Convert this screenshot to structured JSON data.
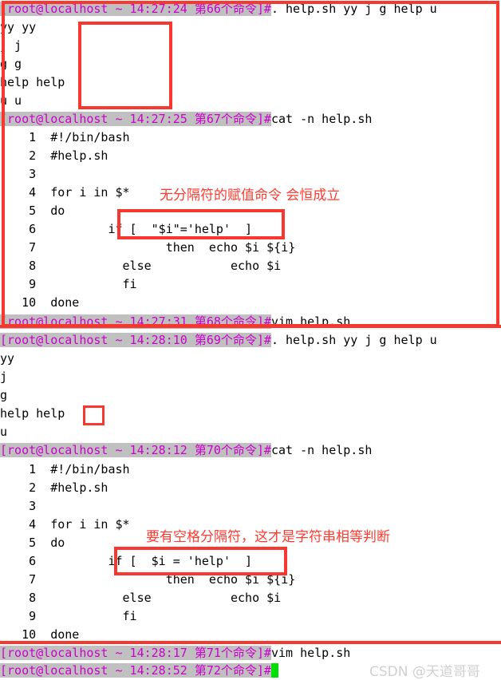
{
  "terminal": {
    "host_user": "root@localhost",
    "cwd": "~",
    "lines": [
      {
        "kind": "prompt",
        "prompt": "[root@localhost ~ 14:27:24 第66个命令]#",
        "command": ". help.sh yy j g help u"
      },
      {
        "kind": "output",
        "text": "yy yy"
      },
      {
        "kind": "output",
        "text": "j j"
      },
      {
        "kind": "output",
        "text": "g g"
      },
      {
        "kind": "output",
        "text": "help help"
      },
      {
        "kind": "output",
        "text": "u u"
      },
      {
        "kind": "prompt",
        "prompt": "[root@localhost ~ 14:27:25 第67个命令]#",
        "command": "cat -n help.sh"
      },
      {
        "kind": "output",
        "text": "     1\t#!/bin/bash"
      },
      {
        "kind": "output",
        "text": "     2\t#help.sh"
      },
      {
        "kind": "output",
        "text": "     3\t"
      },
      {
        "kind": "output",
        "text": "     4\tfor i in $*"
      },
      {
        "kind": "output",
        "text": "     5\tdo"
      },
      {
        "kind": "output",
        "text": "     6\t        if [  \"$i\"='help'  ]"
      },
      {
        "kind": "output",
        "text": "     7\t                then  echo $i ${i}"
      },
      {
        "kind": "output",
        "text": "     8\t          else          echo $i"
      },
      {
        "kind": "output",
        "text": "     9\t          fi"
      },
      {
        "kind": "output",
        "text": "    10\tdone"
      },
      {
        "kind": "prompt",
        "prompt": "[root@localhost ~ 14:27:31 第68个命令]#",
        "command": "vim help.sh"
      },
      {
        "kind": "prompt",
        "prompt": "[root@localhost ~ 14:28:10 第69个命令]#",
        "command": ". help.sh yy j g help u"
      },
      {
        "kind": "output",
        "text": "yy"
      },
      {
        "kind": "output",
        "text": "j"
      },
      {
        "kind": "output",
        "text": "g"
      },
      {
        "kind": "output",
        "text": "help help"
      },
      {
        "kind": "output",
        "text": "u"
      },
      {
        "kind": "prompt",
        "prompt": "[root@localhost ~ 14:28:12 第70个命令]#",
        "command": "cat -n help.sh"
      },
      {
        "kind": "output",
        "text": "     1\t#!/bin/bash"
      },
      {
        "kind": "output",
        "text": "     2\t#help.sh"
      },
      {
        "kind": "output",
        "text": "     3\t"
      },
      {
        "kind": "output",
        "text": "     4\tfor i in $*"
      },
      {
        "kind": "output",
        "text": "     5\tdo"
      },
      {
        "kind": "output",
        "text": "     6\t        if [  $i = 'help'  ]"
      },
      {
        "kind": "output",
        "text": "     7\t                then  echo $i ${i}"
      },
      {
        "kind": "output",
        "text": "     8\t          else          echo $i"
      },
      {
        "kind": "output",
        "text": "     9\t          fi"
      },
      {
        "kind": "output",
        "text": "    10\tdone"
      },
      {
        "kind": "prompt",
        "prompt": "[root@localhost ~ 14:28:17 第71个命令]#",
        "command": "vim help.sh"
      },
      {
        "kind": "prompt_cursor",
        "prompt": "[root@localhost ~ 14:28:52 第72个命令]#",
        "command": ""
      }
    ]
  },
  "rows": {
    "r1_prompt": "[root@localhost ~ 14:27:24 第66个命令]#",
    "r1_cmd": ". help.sh yy j g help u",
    "r2": "yy yy",
    "r3": "j j",
    "r4": "g g",
    "r5": "help help",
    "r6": "u u",
    "r7_prompt": "[root@localhost ~ 14:27:25 第67个命令]#",
    "r7_cmd": "cat -n help.sh",
    "s1_l1": "    1  #!/bin/bash",
    "s1_l2": "    2  #help.sh",
    "s1_l3": "    3",
    "s1_l4": "    4  for i in $*",
    "s1_l5": "    5  do",
    "s1_l6": "    6          if [  \"$i\"='help'  ]",
    "s1_l7": "    7                  then  echo $i ${i}",
    "s1_l8": "    8            else           echo $i",
    "s1_l9": "    9            fi",
    "s1_l10": "   10  done",
    "r8_prompt": "[root@localhost ~ 14:27:31 第68个命令]#",
    "r8_cmd": "vim help.sh",
    "r9_prompt": "[root@localhost ~ 14:28:10 第69个命令]#",
    "r9_cmd": ". help.sh yy j g help u",
    "r10": "yy",
    "r11": "j",
    "r12": "g",
    "r13": "help help",
    "r14": "u",
    "r15_prompt": "[root@localhost ~ 14:28:12 第70个命令]#",
    "r15_cmd": "cat -n help.sh",
    "s2_l1": "    1  #!/bin/bash",
    "s2_l2": "    2  #help.sh",
    "s2_l3": "    3",
    "s2_l4": "    4  for i in $*",
    "s2_l5": "    5  do",
    "s2_l6": "    6          if [  $i = 'help'  ]",
    "s2_l7": "    7                  then  echo $i ${i}",
    "s2_l8": "    8            else           echo $i",
    "s2_l9": "    9            fi",
    "s2_l10": "   10  done",
    "r16_prompt": "[root@localhost ~ 14:28:17 第71个命令]#",
    "r16_cmd": "vim help.sh",
    "r17_prompt": "[root@localhost ~ 14:28:52 第72个命令]#"
  },
  "annotations": {
    "note_top": "无分隔符的赋值命令 会恒成立",
    "note_bottom": "要有空格分隔符，这才是字符串相等判断"
  },
  "watermark": {
    "text": "CSDN @天道哥哥"
  },
  "colors": {
    "prompt_fg": "#cc00cc",
    "prompt_bg": "#c0c0c0",
    "annotation_red": "#fd3b30",
    "box_red": "#f7382f",
    "cursor_green": "#00e000",
    "text_fg": "#000000",
    "watermark_fg": "#d0d0d0",
    "background": "#ffffff"
  }
}
